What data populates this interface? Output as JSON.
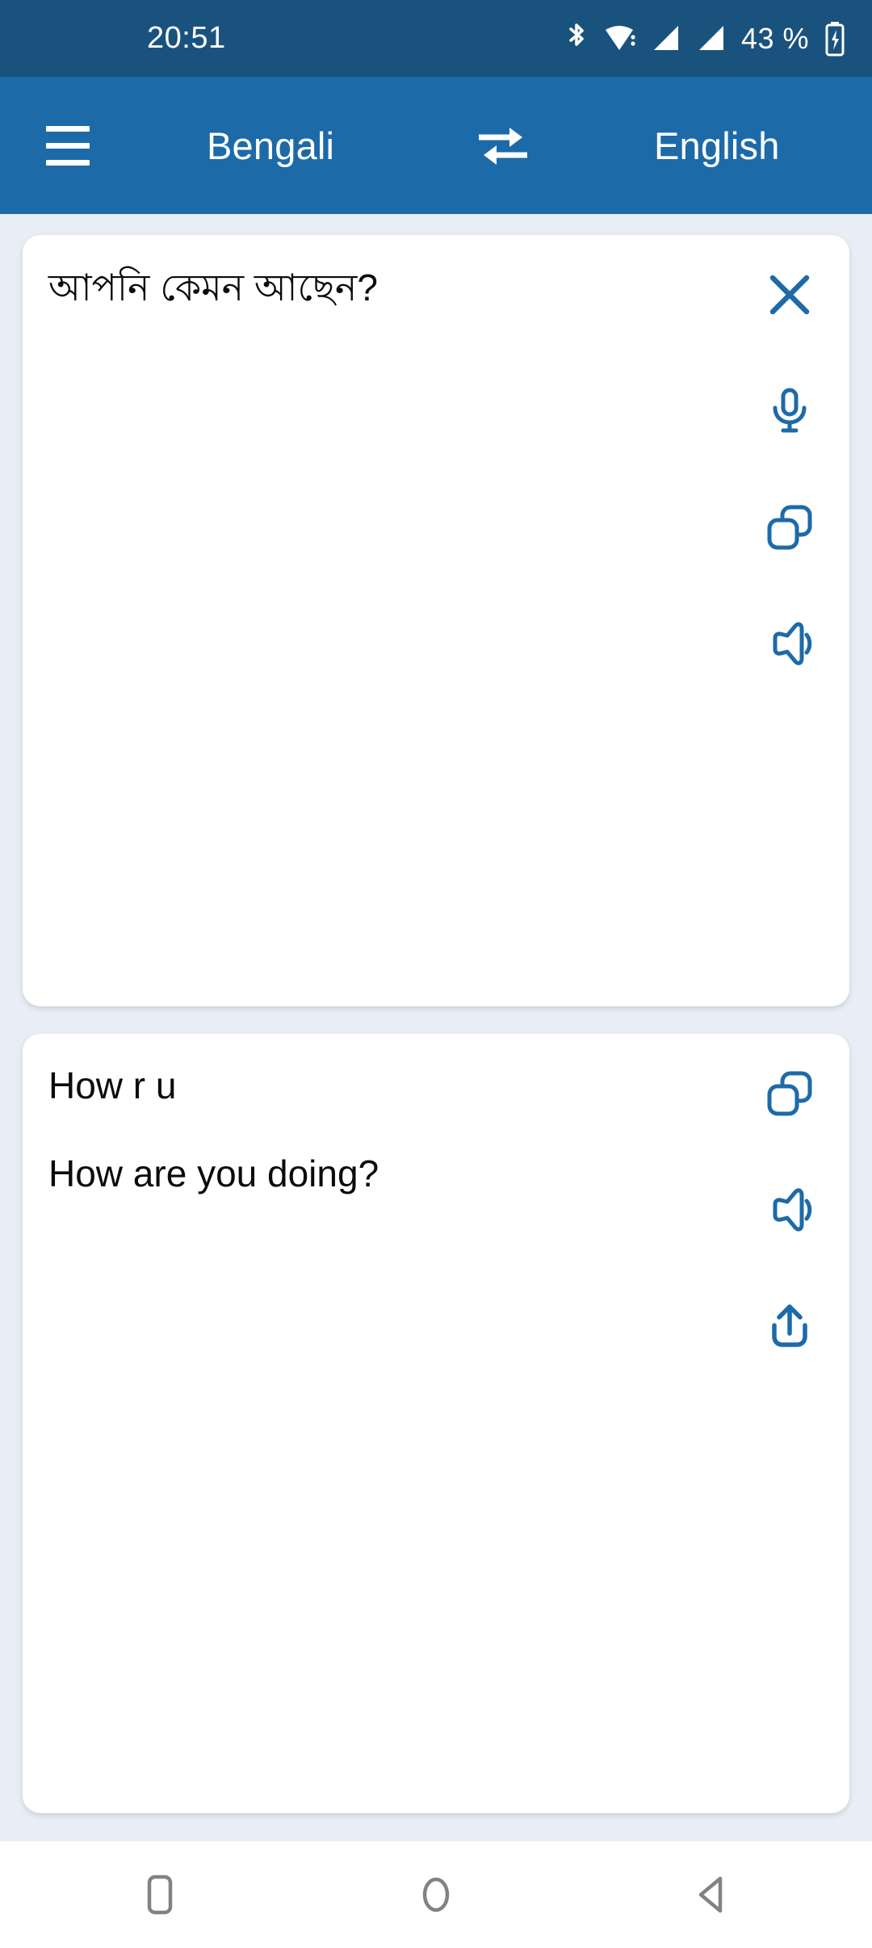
{
  "status_bar": {
    "time": "20:51",
    "battery_text": "43 %",
    "icons": [
      "bluetooth-icon",
      "wifi-icon",
      "signal-1-icon",
      "signal-2-icon",
      "battery-charging-icon"
    ],
    "background_color": "#1a527e"
  },
  "app_bar": {
    "menu_label": "menu-icon",
    "source_language": "Bengali",
    "swap_label": "swap-languages-icon",
    "target_language": "English",
    "background_color": "#1d6aa8",
    "text_color": "#ffffff"
  },
  "source_card": {
    "text": "আপনি কেমন আছেন?",
    "actions": [
      {
        "name": "clear-button",
        "icon": "close-icon"
      },
      {
        "name": "microphone-button",
        "icon": "microphone-icon"
      },
      {
        "name": "copy-button",
        "icon": "copy-icon"
      },
      {
        "name": "speak-button",
        "icon": "speaker-icon"
      }
    ]
  },
  "target_card": {
    "transliteration": "How r u",
    "translation": "How are you doing?",
    "actions": [
      {
        "name": "copy-button",
        "icon": "copy-icon"
      },
      {
        "name": "speak-button",
        "icon": "speaker-icon"
      },
      {
        "name": "share-button",
        "icon": "share-icon"
      }
    ]
  },
  "nav_bar": {
    "recents": "recents-icon",
    "home": "home-icon",
    "back": "back-icon",
    "icon_color": "#808285"
  },
  "theme": {
    "accent": "#1d6aa8",
    "status_bar": "#1a527e",
    "page_background": "#e9eef6",
    "card_background": "#ffffff",
    "icon_blue": "#1d6aa8"
  }
}
